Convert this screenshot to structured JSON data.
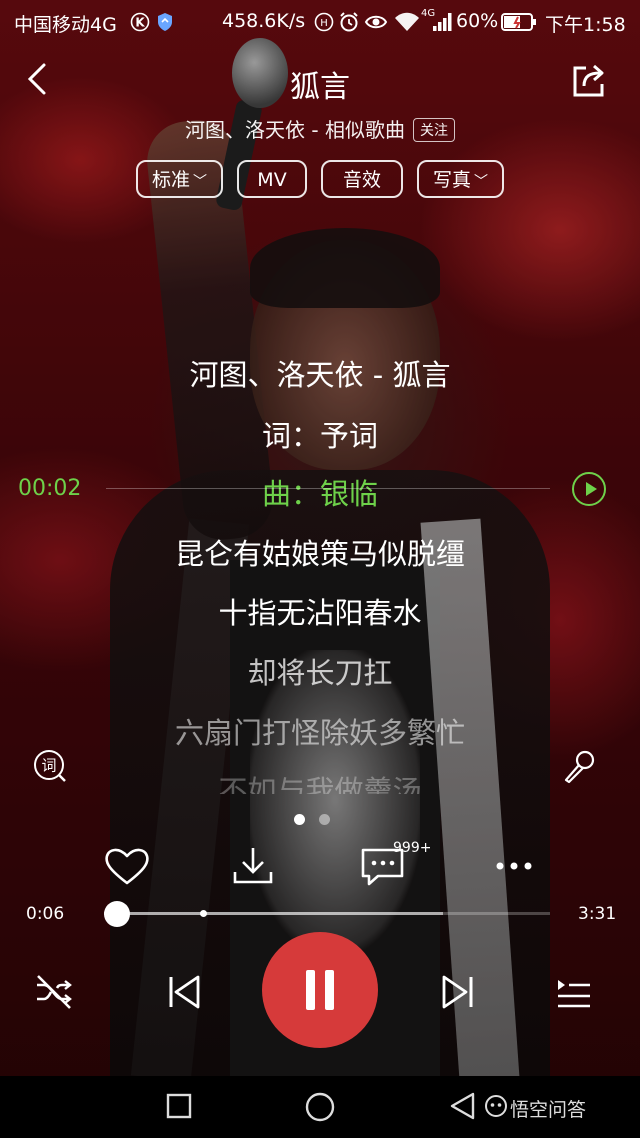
{
  "status_bar": {
    "carrier": "中国移动4G",
    "speed": "458.6K/s",
    "network": "4G",
    "battery": "60%",
    "time": "下午1:58"
  },
  "header": {
    "title": "狐言",
    "subtitle": "河图、洛天依 - 相似歌曲",
    "follow_label": "关注"
  },
  "options": {
    "quality": "标准",
    "mv": "MV",
    "effects": "音效",
    "photo": "写真"
  },
  "lyrics": {
    "lines": [
      "河图、洛天依 - 狐言",
      "词：予词",
      "曲：银临",
      "昆仑有姑娘策马似脱缰",
      "十指无沾阳春水",
      "却将长刀扛",
      "六扇门打怪除妖多繁忙",
      "不如与我做羹汤"
    ],
    "active_index": 2,
    "current_line_time": "00:02"
  },
  "actions": {
    "comment_count": "999+"
  },
  "player": {
    "current_time": "0:06",
    "total_time": "3:31",
    "progress": 0.03,
    "buffered": 0.76
  },
  "watermark": {
    "text": "悟空问答"
  },
  "colors": {
    "accent_green": "#6ed14a",
    "play_red": "#d63a3a"
  },
  "icons": {
    "back": "back-icon",
    "share": "share-icon",
    "lyrics_toggle": "lyrics-icon",
    "karaoke": "microphone-icon",
    "like": "heart-icon",
    "download": "download-icon",
    "comment": "comment-icon",
    "more": "more-icon",
    "play_mode": "shuffle-icon",
    "previous": "previous-icon",
    "pause": "pause-icon",
    "next": "next-icon",
    "playlist": "playlist-icon"
  }
}
